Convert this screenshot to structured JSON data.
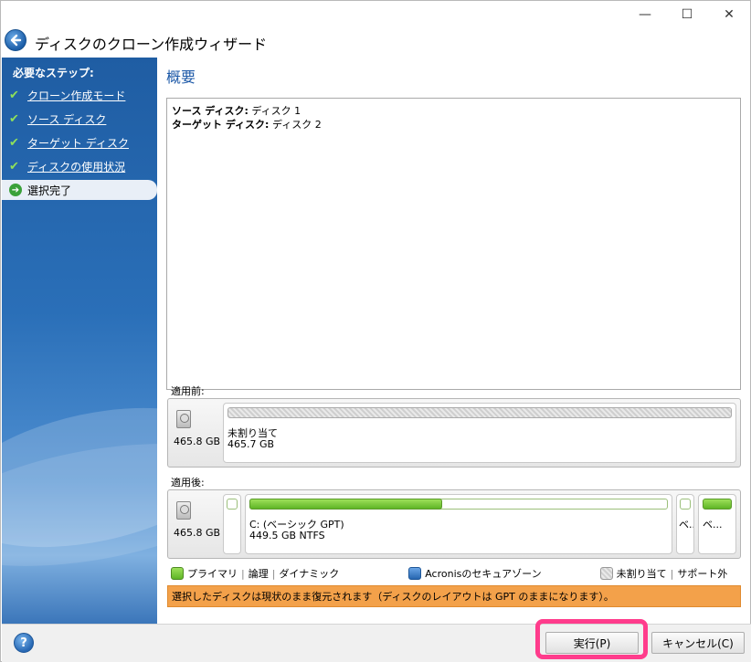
{
  "window": {
    "title": "ディスクのクローン作成ウィザード",
    "controls": {
      "minimize": "—",
      "maximize": "☐",
      "close": "✕"
    }
  },
  "sidebar": {
    "heading": "必要なステップ:",
    "steps": [
      {
        "label": "クローン作成モード",
        "state": "done"
      },
      {
        "label": "ソース ディスク",
        "state": "done"
      },
      {
        "label": "ターゲット ディスク",
        "state": "done"
      },
      {
        "label": "ディスクの使用状況",
        "state": "done"
      },
      {
        "label": "選択完了",
        "state": "current"
      }
    ]
  },
  "main": {
    "title": "概要",
    "summary": {
      "source_label": "ソース ディスク:",
      "source_value": "ディスク 1",
      "target_label": "ターゲット ディスク:",
      "target_value": "ディスク 2"
    },
    "before": {
      "label": "適用前:",
      "disk_size": "465.8 GB",
      "partition_name": "未割り当て",
      "partition_size": "465.7 GB"
    },
    "after": {
      "label": "適用後:",
      "disk_size": "465.8 GB",
      "small1_label": "",
      "main_partition_name": "C: (ベーシック GPT)",
      "main_partition_size": "449.5 GB  NTFS",
      "main_partition_used_fraction": 0.46,
      "small2_label": "ベ...",
      "small3_label": "ベ..."
    },
    "legend": {
      "primary": "プライマリ",
      "logical": "論理",
      "dynamic": "ダイナミック",
      "acronis": "Acronisのセキュアゾーン",
      "unallocated": "未割り当て",
      "unsupported": "サポート外"
    },
    "warning": "選択したディスクは現状のまま復元されます（ディスクのレイアウトは GPT のままになります）。"
  },
  "footer": {
    "help": "?",
    "execute_label": "実行(P)",
    "cancel_label": "キャンセル(C)"
  },
  "colors": {
    "accent_title": "#1e5aa8",
    "warning_bg": "#f3a14a",
    "highlight": "#ff3c8c",
    "partition_green": "#5fb526"
  }
}
